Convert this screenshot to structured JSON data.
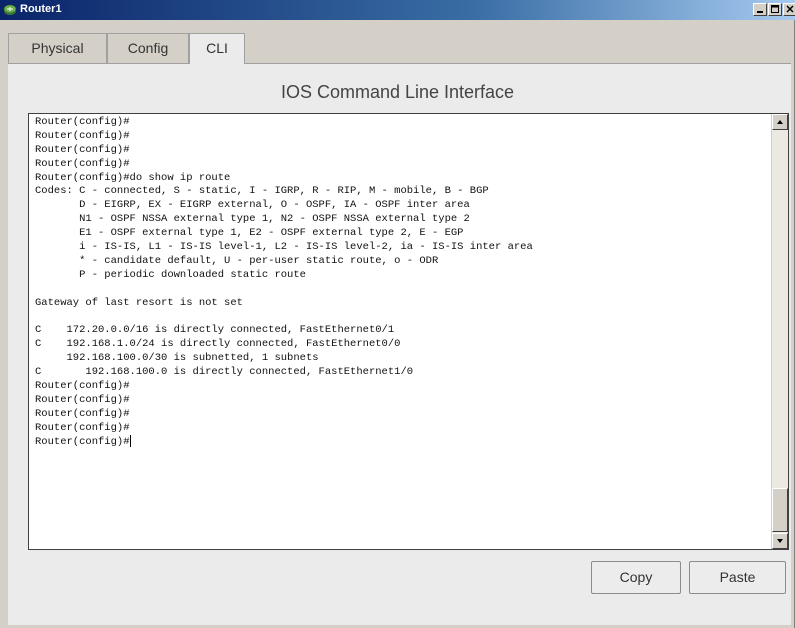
{
  "window": {
    "title": "Router1"
  },
  "tabs": [
    {
      "label": "Physical",
      "active": false
    },
    {
      "label": "Config",
      "active": false
    },
    {
      "label": "CLI",
      "active": true
    }
  ],
  "heading": "IOS Command Line Interface",
  "terminal": {
    "lines": [
      "Router(config)#",
      "Router(config)#",
      "Router(config)#",
      "Router(config)#",
      "Router(config)#do show ip route",
      "Codes: C - connected, S - static, I - IGRP, R - RIP, M - mobile, B - BGP",
      "       D - EIGRP, EX - EIGRP external, O - OSPF, IA - OSPF inter area",
      "       N1 - OSPF NSSA external type 1, N2 - OSPF NSSA external type 2",
      "       E1 - OSPF external type 1, E2 - OSPF external type 2, E - EGP",
      "       i - IS-IS, L1 - IS-IS level-1, L2 - IS-IS level-2, ia - IS-IS inter area",
      "       * - candidate default, U - per-user static route, o - ODR",
      "       P - periodic downloaded static route",
      "",
      "Gateway of last resort is not set",
      "",
      "C    172.20.0.0/16 is directly connected, FastEthernet0/1",
      "C    192.168.1.0/24 is directly connected, FastEthernet0/0",
      "     192.168.100.0/30 is subnetted, 1 subnets",
      "C       192.168.100.0 is directly connected, FastEthernet1/0",
      "Router(config)#",
      "Router(config)#",
      "Router(config)#",
      "Router(config)#",
      "Router(config)#"
    ]
  },
  "buttons": {
    "copy": "Copy",
    "paste": "Paste"
  },
  "colors": {
    "titlebar_start": "#0a246a",
    "titlebar_end": "#a6caf0",
    "panel_bg": "#ebebeb",
    "chrome_bg": "#d4d0c8"
  },
  "icons": [
    "router-app-icon",
    "minimize-icon",
    "maximize-icon",
    "close-icon",
    "scroll-up-arrow-icon",
    "scroll-down-arrow-icon"
  ]
}
